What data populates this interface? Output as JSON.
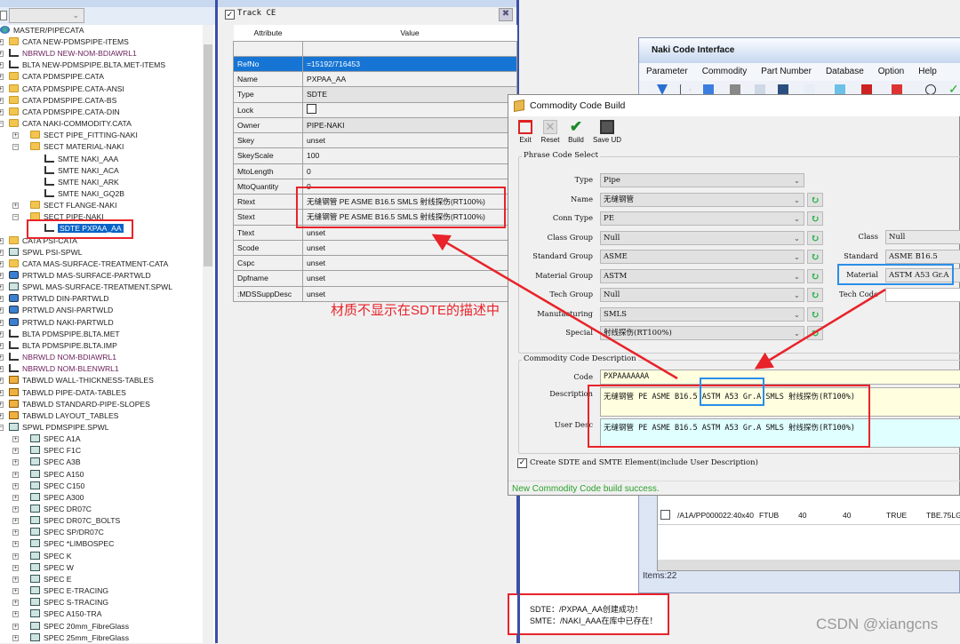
{
  "tree": {
    "root": "MASTER/PIPECATA",
    "items": [
      {
        "label": "CATA NEW-PDMSPIPE-ITEMS",
        "icon": "folder-icon",
        "indent": 0
      },
      {
        "label": "NBRWLD NEW-NOM-BDIAWRL1",
        "icon": "hierarchy-icon",
        "indent": 0,
        "color": "#6a1f5a"
      },
      {
        "label": "BLTA NEW-PDMSPIPE.BLTA.MET-ITEMS",
        "icon": "hierarchy-icon",
        "indent": 0
      },
      {
        "label": "CATA PDMSPIPE.CATA",
        "icon": "folder-icon",
        "indent": 0
      },
      {
        "label": "CATA PDMSPIPE.CATA-ANSI",
        "icon": "folder-icon",
        "indent": 0
      },
      {
        "label": "CATA PDMSPIPE.CATA-BS",
        "icon": "folder-icon",
        "indent": 0
      },
      {
        "label": "CATA PDMSPIPE.CATA-DIN",
        "icon": "folder-icon",
        "indent": 0
      },
      {
        "label": "CATA NAKI-COMMODITY.CATA",
        "icon": "folder-icon",
        "indent": 0,
        "expanded": true
      },
      {
        "label": "SECT PIPE_FITTING-NAKI",
        "icon": "folder-icon",
        "indent": 1
      },
      {
        "label": "SECT MATERIAL-NAKI",
        "icon": "folder-icon",
        "indent": 1,
        "expanded": true
      },
      {
        "label": "SMTE NAKI_AAA",
        "icon": "hierarchy-icon",
        "indent": 2
      },
      {
        "label": "SMTE NAKI_ACA",
        "icon": "hierarchy-icon",
        "indent": 2
      },
      {
        "label": "SMTE NAKI_ARK",
        "icon": "hierarchy-icon",
        "indent": 2
      },
      {
        "label": "SMTE NAKI_GQ2B",
        "icon": "hierarchy-icon",
        "indent": 2
      },
      {
        "label": "SECT FLANGE-NAKI",
        "icon": "folder-icon",
        "indent": 1
      },
      {
        "label": "SECT PIPE-NAKI",
        "icon": "folder-icon",
        "indent": 1,
        "expanded": true
      },
      {
        "label": "SDTE PXPAA_AA",
        "icon": "hierarchy-icon",
        "indent": 2,
        "selected": true
      },
      {
        "label": "CATA PSI-CATA",
        "icon": "folder-icon",
        "indent": 0
      },
      {
        "label": "SPWL PSI-SPWL",
        "icon": "spec-icon",
        "indent": 0
      },
      {
        "label": "CATA MAS-SURFACE-TREATMENT-CATA",
        "icon": "folder-icon",
        "indent": 0
      },
      {
        "label": "PRTWLD MAS-SURFACE-PARTWLD",
        "icon": "partworld-icon",
        "indent": 0
      },
      {
        "label": "SPWL MAS-SURFACE-TREATMENT.SPWL",
        "icon": "spec-icon",
        "indent": 0
      },
      {
        "label": "PRTWLD DIN-PARTWLD",
        "icon": "partworld-icon",
        "indent": 0
      },
      {
        "label": "PRTWLD ANSI-PARTWLD",
        "icon": "partworld-icon",
        "indent": 0
      },
      {
        "label": "PRTWLD NAKI-PARTWLD",
        "icon": "partworld-icon",
        "indent": 0
      },
      {
        "label": "BLTA PDMSPIPE.BLTA.MET",
        "icon": "hierarchy-icon",
        "indent": 0
      },
      {
        "label": "BLTA PDMSPIPE.BLTA.IMP",
        "icon": "hierarchy-icon",
        "indent": 0
      },
      {
        "label": "NBRWLD NOM-BDIAWRL1",
        "icon": "hierarchy-icon",
        "indent": 0,
        "color": "#6a1f5a"
      },
      {
        "label": "NBRWLD NOM-BLENWRL1",
        "icon": "hierarchy-icon",
        "indent": 0,
        "color": "#6a1f5a"
      },
      {
        "label": "TABWLD WALL-THICKNESS-TABLES",
        "icon": "table-folder-icon",
        "indent": 0
      },
      {
        "label": "TABWLD PIPE-DATA-TABLES",
        "icon": "table-folder-icon",
        "indent": 0
      },
      {
        "label": "TABWLD STANDARD-PIPE-SLOPES",
        "icon": "table-folder-icon",
        "indent": 0
      },
      {
        "label": "TABWLD LAYOUT_TABLES",
        "icon": "table-folder-icon",
        "indent": 0
      },
      {
        "label": "SPWL PDMSPIPE.SPWL",
        "icon": "spec-icon",
        "indent": 0,
        "expanded": true
      },
      {
        "label": "SPEC A1A",
        "icon": "spec-icon",
        "indent": 1
      },
      {
        "label": "SPEC F1C",
        "icon": "spec-icon",
        "indent": 1
      },
      {
        "label": "SPEC A3B",
        "icon": "spec-icon",
        "indent": 1
      },
      {
        "label": "SPEC A150",
        "icon": "spec-icon",
        "indent": 1
      },
      {
        "label": "SPEC C150",
        "icon": "spec-icon",
        "indent": 1
      },
      {
        "label": "SPEC A300",
        "icon": "spec-icon",
        "indent": 1
      },
      {
        "label": "SPEC DR07C",
        "icon": "spec-icon",
        "indent": 1
      },
      {
        "label": "SPEC DR07C_BOLTS",
        "icon": "spec-icon",
        "indent": 1
      },
      {
        "label": "SPEC SP/DR07C",
        "icon": "spec-icon",
        "indent": 1
      },
      {
        "label": "SPEC *LIMBOSPEC",
        "icon": "spec-icon",
        "indent": 1
      },
      {
        "label": "SPEC K",
        "icon": "spec-icon",
        "indent": 1
      },
      {
        "label": "SPEC W",
        "icon": "spec-icon",
        "indent": 1
      },
      {
        "label": "SPEC E",
        "icon": "spec-icon",
        "indent": 1
      },
      {
        "label": "SPEC E-TRACING",
        "icon": "spec-icon",
        "indent": 1
      },
      {
        "label": "SPEC S-TRACING",
        "icon": "spec-icon",
        "indent": 1
      },
      {
        "label": "SPEC A150-TRA",
        "icon": "spec-icon",
        "indent": 1
      },
      {
        "label": "SPEC 20mm_FibreGlass",
        "icon": "spec-icon",
        "indent": 1
      },
      {
        "label": "SPEC 25mm_FibreGlass",
        "icon": "spec-icon",
        "indent": 1
      }
    ]
  },
  "attributes": {
    "track_label": "Track CE",
    "track_checked": true,
    "col_attribute": "Attribute",
    "col_value": "Value",
    "rows": [
      {
        "name": "RefNo",
        "value": "=15192/716453"
      },
      {
        "name": "Name",
        "value": "PXPAA_AA"
      },
      {
        "name": "Type",
        "value": "SDTE"
      },
      {
        "name": "Lock",
        "value": "",
        "checkbox": true
      },
      {
        "name": "Owner",
        "value": "PIPE-NAKI"
      },
      {
        "name": "Skey",
        "value": "unset"
      },
      {
        "name": "SkeyScale",
        "value": "100"
      },
      {
        "name": "MtoLength",
        "value": "0"
      },
      {
        "name": "MtoQuantity",
        "value": "0"
      },
      {
        "name": "Rtext",
        "value": "无缝钢管 PE ASME B16.5 SMLS 射线探伤(RT100%)"
      },
      {
        "name": "Stext",
        "value": "无缝钢管 PE ASME B16.5 SMLS 射线探伤(RT100%)"
      },
      {
        "name": "Ttext",
        "value": "unset"
      },
      {
        "name": "Scode",
        "value": "unset"
      },
      {
        "name": "Cspc",
        "value": "unset"
      },
      {
        "name": "Dpfname",
        "value": "unset"
      },
      {
        "name": ":MDSSuppDesc",
        "value": "unset"
      }
    ]
  },
  "annotation": "材质不显示在SDTE的描述中",
  "naki": {
    "title": "Naki Code Interface",
    "menu": [
      "Parameter",
      "Commodity",
      "Part Number",
      "Database",
      "Option",
      "Help"
    ],
    "table_row": [
      "/A1A/PP000022:40x40",
      "FTUB",
      "40",
      "40",
      "TRUE",
      "TBE.75LG"
    ],
    "items": "Items:22"
  },
  "ccb": {
    "title": "Commodity Code Build",
    "toolbar": [
      "Exit",
      "Reset",
      "Build",
      "Save UD"
    ],
    "phrase_group": "Phrase Code Select",
    "fields": [
      {
        "label": "Type",
        "value": "Pipe",
        "refresh": false
      },
      {
        "label": "Name",
        "value": "无缝钢管",
        "refresh": true
      },
      {
        "label": "Conn Type",
        "value": "PE",
        "refresh": true
      },
      {
        "label": "Class Group",
        "value": "Null",
        "refresh": true
      },
      {
        "label": "Standard Group",
        "value": "ASME",
        "refresh": true
      },
      {
        "label": "Material Group",
        "value": "ASTM",
        "refresh": true
      },
      {
        "label": "Tech Group",
        "value": "Null",
        "refresh": true
      },
      {
        "label": "Manufacturing",
        "value": "SMLS",
        "refresh": true
      },
      {
        "label": "Special",
        "value": "射线探伤(RT100%)",
        "refresh": true
      }
    ],
    "right_fields": [
      {
        "label": "Class",
        "value": "Null"
      },
      {
        "label": "Standard",
        "value": "ASME B16.5"
      },
      {
        "label": "Material",
        "value": "ASTM A53 Gr.A"
      },
      {
        "label": "Tech Code",
        "value": ""
      }
    ],
    "desc_group": "Commodity Code Description",
    "code_label": "Code",
    "code": "PXPAAAAAAA",
    "desc_label": "Description",
    "description": "无缝钢管 PE ASME B16.5 ASTM A53 Gr.A SMLS 射线探伤(RT100%)",
    "udesc_label": "User Desc",
    "user_desc": "无缝钢管 PE ASME B16.5 ASTM A53 Gr.A SMLS 射线探伤(RT100%)",
    "create_label": "Create SDTE and SMTE Element(include User Description)",
    "create_checked": true,
    "status": "New Commodity Code build success."
  },
  "messages": [
    "SDTE：/PXPAA_AA创建成功！",
    "SMTE：/NAKI_AAA在库中已存在！"
  ],
  "watermark": "CSDN @xiangcns",
  "colors": {
    "highlight_red": "#e8232a",
    "highlight_blue": "#2a8ee8",
    "status_green": "#2ca02c",
    "selection": "#0a64c8"
  }
}
